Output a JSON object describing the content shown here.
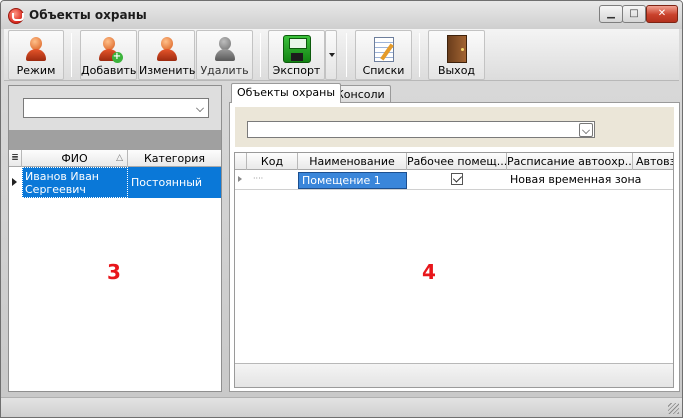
{
  "window": {
    "title": "Объекты охраны",
    "minimize_glyph": "▁",
    "maximize_glyph": "□",
    "close_glyph": "✕"
  },
  "toolbar": {
    "mode": "Режим",
    "add": "Добавить",
    "edit": "Изменить",
    "delete": "Удалить",
    "export": "Экспорт",
    "lists": "Списки",
    "exit": "Выход"
  },
  "left_grid": {
    "columns": [
      "ФИО",
      "Категория"
    ],
    "sort_glyph": "△",
    "rows_glyph": "≣",
    "rows": [
      {
        "fio": "Иванов Иван Сергеевич",
        "category": "Постоянный",
        "selected": true
      }
    ]
  },
  "tabs": [
    "Объекты охраны",
    "Консоли"
  ],
  "right_grid": {
    "columns": [
      "Код",
      "Наименование",
      "Рабочее помещ...",
      "Расписание автоохр...",
      "Автовз"
    ],
    "rows": [
      {
        "code": "····",
        "name": "Помещение 1",
        "workroom": true,
        "schedule": "Новая временная зона",
        "auto": ""
      }
    ]
  },
  "annotations": {
    "left": "3",
    "right": "4"
  },
  "colors": {
    "selection": "#0a78d8",
    "annotation": "#e8161b"
  },
  "icons": {
    "mode": "person-icon",
    "add": "person-add-icon",
    "edit": "person-edit-icon",
    "delete": "person-delete-icon",
    "export": "floppy-disk-icon",
    "lists": "notepad-icon",
    "exit": "door-icon"
  }
}
